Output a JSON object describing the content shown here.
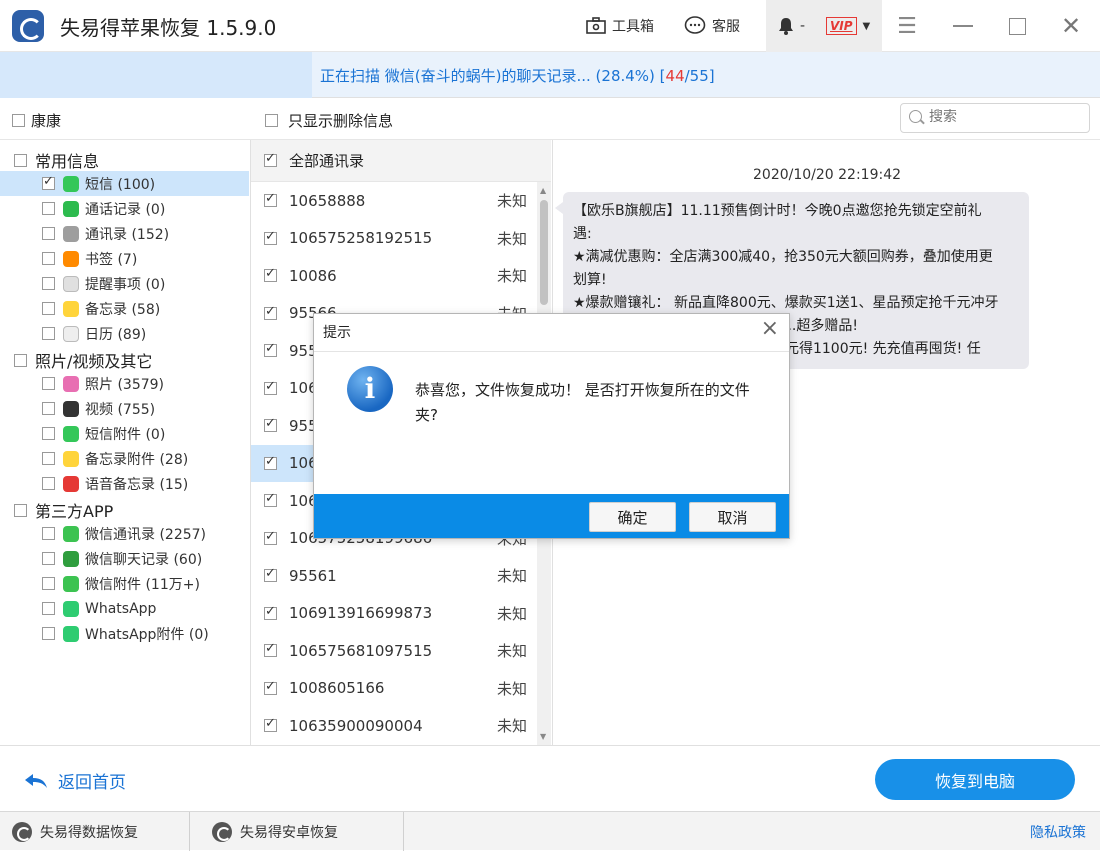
{
  "titlebar": {
    "title": "失易得苹果恢复  1.5.9.0",
    "toolbox_label": "工具箱",
    "service_label": "客服",
    "bell_suffix": "-",
    "vip_label": "VIP"
  },
  "progress": {
    "prefix": "正在扫描 微信(奋斗的蜗牛)的聊天记录... (28.4%)   [",
    "done_count": "44",
    "total": "/55]",
    "percent": 28.4
  },
  "toolbar": {
    "device_label": "康康",
    "only_deleted_label": "只显示删除信息",
    "search_placeholder": "搜索"
  },
  "categories": [
    {
      "label": "常用信息",
      "items": [
        {
          "label": "短信 (100)",
          "checked": true,
          "selected": true,
          "icon": "message-icon",
          "color": "#34c759"
        },
        {
          "label": "通话记录 (0)",
          "checked": false,
          "icon": "phone-icon",
          "color": "#2dbb4e"
        },
        {
          "label": "通讯录 (152)",
          "checked": false,
          "icon": "contacts-icon",
          "color": "#9e9e9e"
        },
        {
          "label": "书签 (7)",
          "checked": false,
          "icon": "bookmark-icon",
          "color": "#ff8a00"
        },
        {
          "label": "提醒事项 (0)",
          "checked": false,
          "icon": "reminders-icon",
          "color": "#e0e0e0"
        },
        {
          "label": "备忘录 (58)",
          "checked": false,
          "icon": "notes-icon",
          "color": "#ffd43b"
        },
        {
          "label": "日历 (89)",
          "checked": false,
          "icon": "calendar-icon",
          "color": "#eeeeee"
        }
      ]
    },
    {
      "label": "照片/视频及其它",
      "items": [
        {
          "label": "照片 (3579)",
          "checked": false,
          "icon": "photos-icon",
          "color": "#e86fb2"
        },
        {
          "label": "视频 (755)",
          "checked": false,
          "icon": "video-icon",
          "color": "#333333"
        },
        {
          "label": "短信附件 (0)",
          "checked": false,
          "icon": "attachment-icon",
          "color": "#34c759"
        },
        {
          "label": "备忘录附件 (28)",
          "checked": false,
          "icon": "notes-attachment-icon",
          "color": "#ffd43b"
        },
        {
          "label": "语音备忘录 (15)",
          "checked": false,
          "icon": "voice-memo-icon",
          "color": "#e53935"
        }
      ]
    },
    {
      "label": "第三方APP",
      "items": [
        {
          "label": "微信通讯录 (2257)",
          "checked": false,
          "icon": "wechat-contacts-icon",
          "color": "#3cc351"
        },
        {
          "label": "微信聊天记录 (60)",
          "checked": false,
          "icon": "wechat-chat-icon",
          "color": "#2f9e3e"
        },
        {
          "label": "微信附件 (11万+)",
          "checked": false,
          "icon": "wechat-attachment-icon",
          "color": "#3cc351"
        },
        {
          "label": "WhatsApp",
          "checked": false,
          "icon": "whatsapp-icon",
          "color": "#2ecc71"
        },
        {
          "label": "WhatsApp附件 (0)",
          "checked": false,
          "icon": "whatsapp-attachment-icon",
          "color": "#2ecc71"
        }
      ]
    }
  ],
  "contacts": {
    "header": "全部通讯录",
    "rows": [
      {
        "number": "10658888",
        "status": "未知"
      },
      {
        "number": "106575258192515",
        "status": "未知"
      },
      {
        "number": "10086",
        "status": "未知"
      },
      {
        "number": "95566",
        "status": "未知"
      },
      {
        "number": "955",
        "status": ""
      },
      {
        "number": "106",
        "status": ""
      },
      {
        "number": "955",
        "status": ""
      },
      {
        "number": "106",
        "status": "",
        "selected": true
      },
      {
        "number": "106",
        "status": ""
      },
      {
        "number": "106575258199686",
        "status": "未知"
      },
      {
        "number": "95561",
        "status": "未知"
      },
      {
        "number": "106913916699873",
        "status": "未知"
      },
      {
        "number": "106575681097515",
        "status": "未知"
      },
      {
        "number": "1008605166",
        "status": "未知"
      },
      {
        "number": "10635900090004",
        "status": "未知"
      }
    ]
  },
  "chat": {
    "time": "2020/10/20 22:19:42",
    "lines": [
      "【欧乐B旗舰店】11.11预售倒计时！今晚0点邀您抢先锁定空前礼",
      "遇:",
      "★满减优惠购：全店满300减40，抢350元大额回购券，叠加使用更",
      "划算!",
      "★爆款赠镶礼： 新品直降800元、爆款买1送1、星品预定抢千元冲牙",
      "器、换小库、复赠超值鸭更有好礼...超多赠品!",
      "★前N名抢先定金预定购 ... 付100元得1100元! 先充值再囤货! 任"
    ]
  },
  "bottom": {
    "back_label": "返回首页",
    "recover_label": "恢复到电脑"
  },
  "footer": {
    "data_recovery": "失易得数据恢复",
    "android_recovery": "失易得安卓恢复",
    "privacy": "隐私政策"
  },
  "dialog": {
    "title": "提示",
    "message": "恭喜您，文件恢复成功！ 是否打开恢复所在的文件夹?",
    "ok_label": "确定",
    "cancel_label": "取消"
  }
}
